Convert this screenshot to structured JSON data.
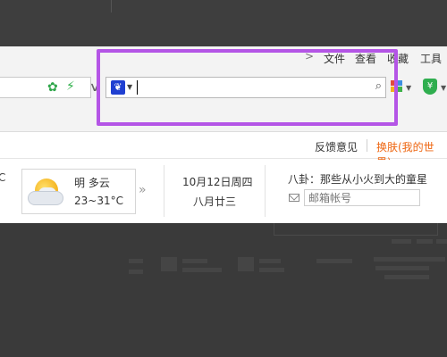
{
  "menu": {
    "chevron": ">",
    "items": [
      "文件",
      "查看",
      "收藏",
      "工具"
    ]
  },
  "toolbar": {
    "search": {
      "engine_icon": "paw-icon",
      "value": ""
    }
  },
  "linkbar": {
    "feedback": "反馈意见",
    "skin": "换肤(我的世界)"
  },
  "weather": {
    "temp_partial": "C",
    "condition": "明 多云",
    "range": "23~31°C",
    "more": "»"
  },
  "date": {
    "gregorian": "10月12日周四",
    "lunar": "八月廿三"
  },
  "gossip": {
    "text": "八卦：那些从小火到大的童星"
  },
  "mail": {
    "placeholder": "邮箱帐号"
  },
  "colors": {
    "highlight": "#b455e6",
    "skin_link": "#ee6611",
    "search_engine": "#1f3fd1"
  }
}
